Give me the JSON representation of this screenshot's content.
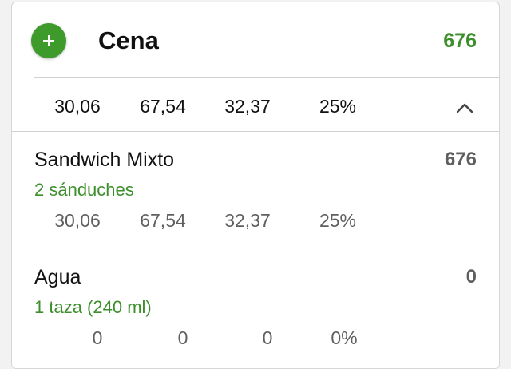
{
  "meal": {
    "title": "Cena",
    "total_calories": "676",
    "macros": [
      "30,06",
      "67,54",
      "32,37",
      "25%"
    ]
  },
  "foods": [
    {
      "name": "Sandwich Mixto",
      "calories": "676",
      "serving": "2 sánduches",
      "macros": [
        "30,06",
        "67,54",
        "32,37",
        "25%"
      ]
    },
    {
      "name": "Agua",
      "calories": "0",
      "serving": "1 taza (240 ml)",
      "macros": [
        "0",
        "0",
        "0",
        "0%"
      ]
    }
  ],
  "icons": {
    "add": "plus-icon",
    "collapse": "chevron-up-icon"
  },
  "colors": {
    "accent_green": "#3f9a2c",
    "calorie_green": "#3c8f2b",
    "secondary_text": "#5f5f5f"
  }
}
